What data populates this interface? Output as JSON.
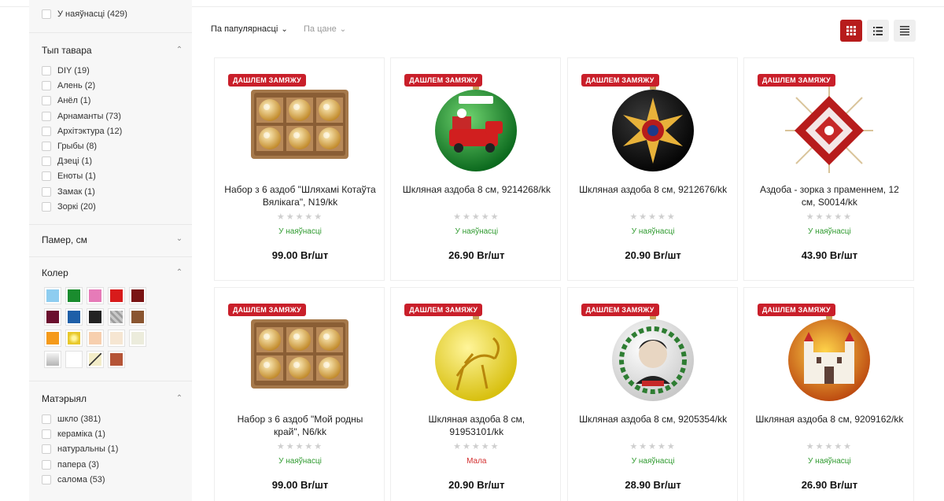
{
  "sidebar": {
    "in_stock_filter": "У наяўнасці (429)",
    "product_type": {
      "title": "Тып тавара",
      "items": [
        "DIY (19)",
        "Алень (2)",
        "Анёл (1)",
        "Арнаманты (73)",
        "Архітэктура (12)",
        "Грыбы (8)",
        "Дзеці (1)",
        "Еноты (1)",
        "Замак (1)",
        "Зоркі (20)"
      ]
    },
    "size": {
      "title": "Памер, см"
    },
    "color": {
      "title": "Колер",
      "swatches": [
        "#8ecdf0",
        "#1a8c2e",
        "#e67bb8",
        "#d81b1b",
        "#7a1414",
        "#6b0f2e",
        "#1e5fa8",
        "#222222",
        "#b8b8b8",
        "#8a5530",
        "#f59a1a",
        "#f2d64a",
        "#f7cfae",
        "#f6e6d2",
        "#ececdc",
        "#d6d6d6",
        "#ffffff",
        "#f2ecc8",
        "#b55436"
      ]
    },
    "material": {
      "title": "Матэрыял",
      "items": [
        "шкло (381)",
        "кераміка (1)",
        "натуральны (1)",
        "папера (3)",
        "салома (53)"
      ]
    }
  },
  "sort": {
    "popularity": "Па папулярнасці",
    "price": "Па цане"
  },
  "colors": {
    "accent": "#b71c1c",
    "badge": "#c91f2a",
    "in_stock": "#2e9a2e",
    "low": "#d32f2f"
  },
  "products": [
    {
      "badge": "ДАШЛЕМ ЗАМЯЖУ",
      "name": "Набор з 6 аздоб \"Шляхамі Котаўта Вялікага\", N19/kk",
      "stars": "★★★★★",
      "stock": "У наяўнасці",
      "stock_status": "in",
      "price": "99.00 Br/шт",
      "image": "box-of-six-ornaments"
    },
    {
      "badge": "ДАШЛЕМ ЗАМЯЖУ",
      "name": "Шкляная аздоба 8 см, 9214268/kk",
      "stars": "★★★★★",
      "stock": "У наяўнасці",
      "stock_status": "in",
      "price": "26.90 Br/шт",
      "image": "green-ball-red-car"
    },
    {
      "badge": "ДАШЛЕМ ЗАМЯЖУ",
      "name": "Шкляная аздоба 8 см, 9212676/kk",
      "stars": "★★★★★",
      "stock": "У наяўнасці",
      "stock_status": "in",
      "price": "20.90 Br/шт",
      "image": "black-ball-star"
    },
    {
      "badge": "ДАШЛЕМ ЗАМЯЖУ",
      "name": "Аздоба - зорка з праменнем, 12 см, S0014/kk",
      "stars": "★★★★★",
      "stock": "У наяўнасці",
      "stock_status": "in",
      "price": "43.90 Br/шт",
      "image": "straw-star"
    },
    {
      "badge": "ДАШЛЕМ ЗАМЯЖУ",
      "name": "Набор з 6 аздоб \"Мой родны край\", N6/kk",
      "stars": "★★★★★",
      "stock": "У наяўнасці",
      "stock_status": "in",
      "price": "99.00 Br/шт",
      "image": "box-of-six-ornaments"
    },
    {
      "badge": "ДАШЛЕМ ЗАМЯЖУ",
      "name": "Шкляная аздоба 8 см, 91953101/kk",
      "stars": "★★★★★",
      "stock": "Мала",
      "stock_status": "low",
      "price": "20.90 Br/шт",
      "image": "yellow-ball-horse"
    },
    {
      "badge": "ДАШЛЕМ ЗАМЯЖУ",
      "name": "Шкляная аздоба 8 см, 9205354/kk",
      "stars": "★★★★★",
      "stock": "У наяўнасці",
      "stock_status": "in",
      "price": "28.90 Br/шт",
      "image": "white-ball-portrait"
    },
    {
      "badge": "ДАШЛЕМ ЗАМЯЖУ",
      "name": "Шкляная аздоба 8 см, 9209162/kk",
      "stars": "★★★★★",
      "stock": "У наяўнасці",
      "stock_status": "in",
      "price": "26.90 Br/шт",
      "image": "orange-ball-castle"
    }
  ]
}
